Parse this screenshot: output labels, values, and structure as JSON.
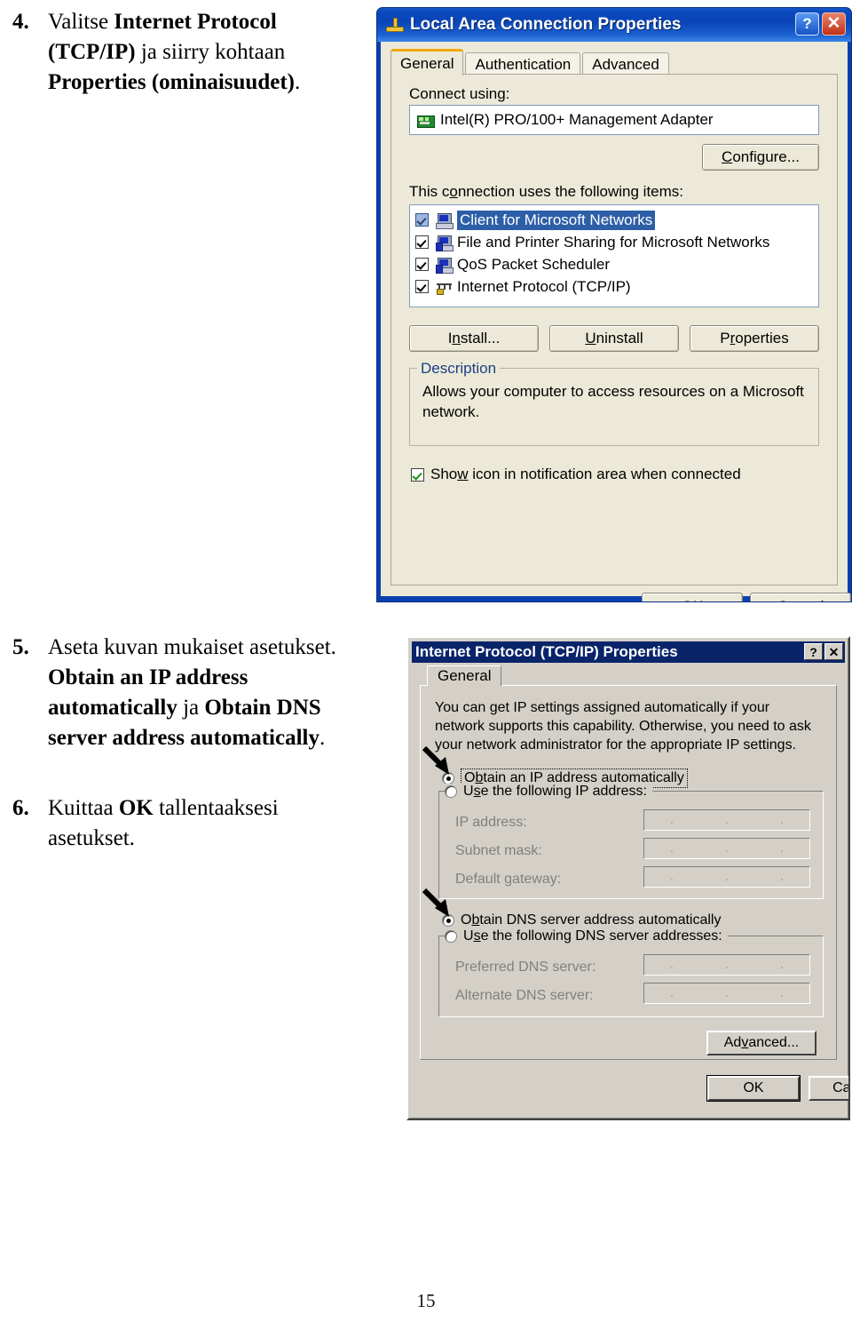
{
  "document": {
    "page_number": "15",
    "steps": [
      {
        "number": "4.",
        "parts": [
          {
            "text": "Valitse ",
            "bold": false
          },
          {
            "text": "Internet Protocol (TCP/IP)",
            "bold": true
          },
          {
            "text": " ja siirry kohtaan ",
            "bold": false
          },
          {
            "text": "Properties (ominaisuudet)",
            "bold": true
          },
          {
            "text": ".",
            "bold": false
          }
        ]
      },
      {
        "number": "5.",
        "parts": [
          {
            "text": "Aseta kuvan mukaiset asetukset. ",
            "bold": false
          },
          {
            "text": "Obtain an IP address automatically",
            "bold": true
          },
          {
            "text": " ja ",
            "bold": false
          },
          {
            "text": "Obtain DNS server address automatically",
            "bold": true
          },
          {
            "text": ".",
            "bold": false
          }
        ]
      },
      {
        "number": "6.",
        "parts": [
          {
            "text": "Kuittaa ",
            "bold": false
          },
          {
            "text": "OK",
            "bold": true
          },
          {
            "text": " tallentaaksesi asetukset.",
            "bold": false
          }
        ]
      }
    ]
  },
  "lan_dialog": {
    "title": "Local Area Connection Properties",
    "title_icon": "network-plug-icon",
    "help_button": "?",
    "close_button": "✕",
    "tabs": [
      {
        "label": "General",
        "active": true
      },
      {
        "label": "Authentication",
        "active": false
      },
      {
        "label": "Advanced",
        "active": false
      }
    ],
    "connect_using_label": "Connect using:",
    "adapter": "Intel(R) PRO/100+ Management Adapter",
    "configure_button": "Configure...",
    "items_label": "This connection uses the following items:",
    "items": [
      {
        "label": "Client for Microsoft Networks",
        "checked": true,
        "selected": true,
        "icon": "client-computer-icon"
      },
      {
        "label": "File and Printer Sharing for Microsoft Networks",
        "checked": true,
        "selected": false,
        "icon": "file-print-sharing-icon"
      },
      {
        "label": "QoS Packet Scheduler",
        "checked": true,
        "selected": false,
        "icon": "qos-scheduler-icon"
      },
      {
        "label": "Internet Protocol (TCP/IP)",
        "checked": true,
        "selected": false,
        "icon": "protocol-icon"
      }
    ],
    "install_button": "Install...",
    "uninstall_button": "Uninstall",
    "properties_button": "Properties",
    "description_group": "Description",
    "description_text": "Allows your computer to access resources on a Microsoft network.",
    "show_icon_checkbox": "Show icon in notification area when connected",
    "show_icon_checked": true,
    "ok_button": "OK",
    "cancel_button": "Cancel",
    "colors": {
      "titlebar": "#0a44b6",
      "face": "#ece9d8",
      "selection": "#2d5fa8",
      "tab_accent": "#f2a900",
      "close": "#c23016"
    }
  },
  "tcp_dialog": {
    "title": "Internet Protocol (TCP/IP) Properties",
    "help_button": "?",
    "close_button": "✕",
    "tab": "General",
    "intro_text": "You can get IP settings assigned automatically if your network supports this capability. Otherwise, you need to ask your network administrator for the appropriate IP settings.",
    "obtain_ip_radio": "Obtain an IP address automatically",
    "obtain_ip_selected": true,
    "use_ip_radio": "Use the following IP address:",
    "use_ip_selected": false,
    "ip_fields": [
      {
        "label": "IP address:",
        "value": ""
      },
      {
        "label": "Subnet mask:",
        "value": ""
      },
      {
        "label": "Default gateway:",
        "value": ""
      }
    ],
    "obtain_dns_radio": "Obtain DNS server address automatically",
    "obtain_dns_selected": true,
    "use_dns_radio": "Use the following DNS server addresses:",
    "use_dns_selected": false,
    "dns_fields": [
      {
        "label": "Preferred DNS server:",
        "value": ""
      },
      {
        "label": "Alternate DNS server:",
        "value": ""
      }
    ],
    "advanced_button": "Advanced...",
    "ok_button": "OK",
    "cancel_button": "Cancel",
    "colors": {
      "titlebar": "#0a246a",
      "face": "#d4d0c8",
      "disabled_text": "#808080"
    }
  }
}
